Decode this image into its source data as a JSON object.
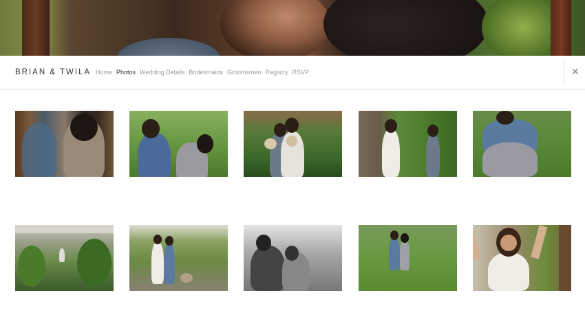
{
  "hero": {
    "alt": "couple close-up banner"
  },
  "header": {
    "brand": "BRIAN & TWILA",
    "nav": [
      {
        "label": "Home",
        "active": false
      },
      {
        "label": "Photos",
        "active": true
      },
      {
        "label": "Wedding Details",
        "active": false
      },
      {
        "label": "Bridesmaids",
        "active": false
      },
      {
        "label": "Groomsmen",
        "active": false
      },
      {
        "label": "Registry",
        "active": false
      },
      {
        "label": "RSVP",
        "active": false
      }
    ],
    "close_glyph": "✕"
  },
  "colors": {
    "brand_text": "#333333",
    "nav_inactive": "#9a9a9a",
    "nav_active": "#333333",
    "divider": "#e4e4e4"
  },
  "photos": [
    {
      "name": "photo-couple-closeup",
      "scene": "couple embracing by wooden post"
    },
    {
      "name": "photo-couple-laughing",
      "scene": "couple laughing in greenery"
    },
    {
      "name": "photo-couple-dogs",
      "scene": "couple holding dogs among plants"
    },
    {
      "name": "photo-couple-hands",
      "scene": "couple holding hands in garden"
    },
    {
      "name": "photo-couple-hug-back",
      "scene": "couple hugging from behind in field"
    },
    {
      "name": "photo-greenhouse",
      "scene": "greenhouse interior with plants"
    },
    {
      "name": "photo-couple-walking-dog",
      "scene": "couple walking with dog on path"
    },
    {
      "name": "photo-couple-bw",
      "scene": "black and white couple portrait"
    },
    {
      "name": "photo-couple-field-dance",
      "scene": "couple dancing in grass field"
    },
    {
      "name": "photo-couple-piggyback",
      "scene": "man smiling with arms raised"
    }
  ]
}
